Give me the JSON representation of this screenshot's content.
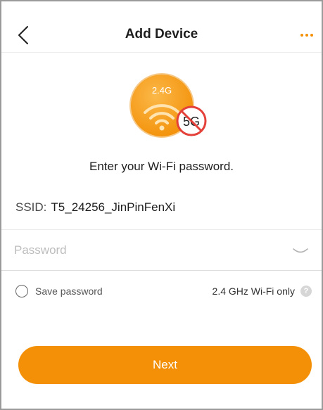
{
  "header": {
    "title": "Add Device",
    "back_icon": "chevron-left",
    "more_icon": "ellipsis"
  },
  "illustration": {
    "band_24": "2.4G",
    "band_5": "5G",
    "wifi_icon": "wifi",
    "no_5g_icon": "prohibited"
  },
  "instruction": "Enter your Wi-Fi password.",
  "ssid": {
    "label": "SSID:",
    "value": "T5_24256_JinPinFenXi"
  },
  "password": {
    "placeholder": "Password",
    "value": "",
    "toggle_icon": "eye-closed"
  },
  "save_password": {
    "label": "Save password",
    "checked": false
  },
  "band_note": {
    "text": "2.4 GHz Wi-Fi only",
    "help_icon": "question-mark"
  },
  "next_button": {
    "label": "Next"
  },
  "colors": {
    "accent": "#f39008",
    "illustration_orange": "#f7a02a",
    "prohibited_red": "#e3413a",
    "text_primary": "#1e1e1e",
    "placeholder": "#bdbdbd"
  }
}
